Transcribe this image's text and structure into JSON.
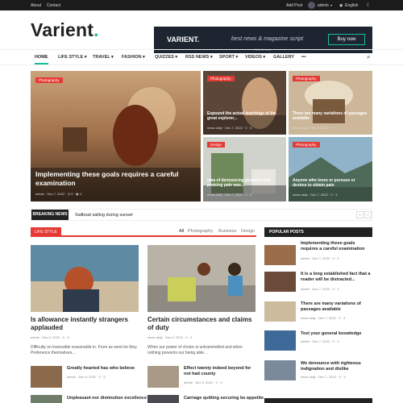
{
  "topbar": {
    "links": [
      "About",
      "Contact"
    ],
    "add_post": "Add Post",
    "user": "admin",
    "language": "English"
  },
  "header": {
    "logo_text": "Varient",
    "logo_dot": "."
  },
  "banner": {
    "title": "VARIENT.",
    "subtitle": "best news & magazine script",
    "button": "Buy now",
    "dims": "728x90 ads"
  },
  "nav": {
    "items": [
      "HOME",
      "LIFE STYLE",
      "TRAVEL",
      "FASHION",
      "QUIZZES",
      "RSS NEWS",
      "SPORT",
      "VIDEOS",
      "GALLERY",
      "•••"
    ]
  },
  "hero": {
    "main": {
      "category": "Photography",
      "title": "Implementing these goals requires a careful examination",
      "author": "admin",
      "date": "Dec 7, 2022",
      "views": "0",
      "comments": "4"
    },
    "items": [
      {
        "category": "Photography",
        "title": "Expound the actual teachings of the great explorer...",
        "author": "news daily",
        "date": "Dec 7, 2022",
        "comments": "0",
        "views": "6"
      },
      {
        "category": "Photography",
        "title": "There are many variations of passages available",
        "author": "news daily",
        "date": "Dec 7, 2022",
        "comments": "0",
        "views": "4"
      },
      {
        "category": "Design",
        "title": "Idea of denouncing pleasure and praising pain was...",
        "author": "news daily",
        "date": "Dec 7, 2022",
        "comments": "0",
        "views": "2"
      },
      {
        "category": "Photography",
        "title": "Anyone who loves or pursues or desires to obtain pain",
        "author": "news daily",
        "date": "Dec 7, 2022",
        "comments": "0",
        "views": "3"
      }
    ]
  },
  "breaking": {
    "label": "BREAKING NEWS",
    "text": "Sailboat sailing during sunset"
  },
  "lifestyle": {
    "label": "LIFE STYLE",
    "tabs": [
      "All",
      "Photography",
      "Business",
      "Design"
    ],
    "cards": [
      {
        "title": "Is allowance instantly strangers applauded",
        "author": "admin",
        "date": "Dec 9, 2022",
        "comments": "0",
        "views": "6",
        "excerpt": "Difficulty on insensible reasonable in. From as went he they. Preference themselves..."
      },
      {
        "title": "Certain circumstances and claims of duty",
        "author": "news daily",
        "date": "Dec 9, 2022",
        "comments": "0",
        "views": "4",
        "excerpt": "When our power of choice is untrammelled and when nothing prevents our being able..."
      }
    ],
    "small": [
      {
        "title": "Greatly hearted has who believe",
        "author": "admin",
        "date": "Dec 9, 2022",
        "comments": "0",
        "views": "5"
      },
      {
        "title": "Effect twenty indeed beyond for not had county",
        "author": "admin",
        "date": "Dec 9, 2022",
        "comments": "0",
        "views": "3"
      },
      {
        "title": "Unpleasant nor diminution excellence",
        "author": "",
        "date": "",
        "comments": "",
        "views": ""
      },
      {
        "title": "Carriage quitting securing be appetite",
        "author": "",
        "date": "",
        "comments": "",
        "views": ""
      }
    ]
  },
  "popular": {
    "label": "POPULAR POSTS",
    "items": [
      {
        "title": "Implementing these goals requires a careful examination",
        "author": "admin",
        "date": "Dec 7, 2022",
        "comments": "0",
        "views": "4"
      },
      {
        "title": "It is a long established fact that a reader will be distracted...",
        "author": "admin",
        "date": "Dec 7, 2022",
        "comments": "0",
        "views": "3"
      },
      {
        "title": "There are many variations of passages available",
        "author": "news daily",
        "date": "Dec 7, 2022",
        "comments": "0",
        "views": "4"
      },
      {
        "title": "Test your general knowledge",
        "author": "admin",
        "date": "Dec 7, 2022",
        "comments": "0",
        "views": "3"
      },
      {
        "title": "We denounce with righteous indignation and dislike",
        "author": "news daily",
        "date": "Dec 7, 2022",
        "comments": "0",
        "views": "3"
      }
    ]
  },
  "colors": {
    "accent": "#1abc9c",
    "category": "#e53935",
    "dark": "#1b1b1b"
  }
}
